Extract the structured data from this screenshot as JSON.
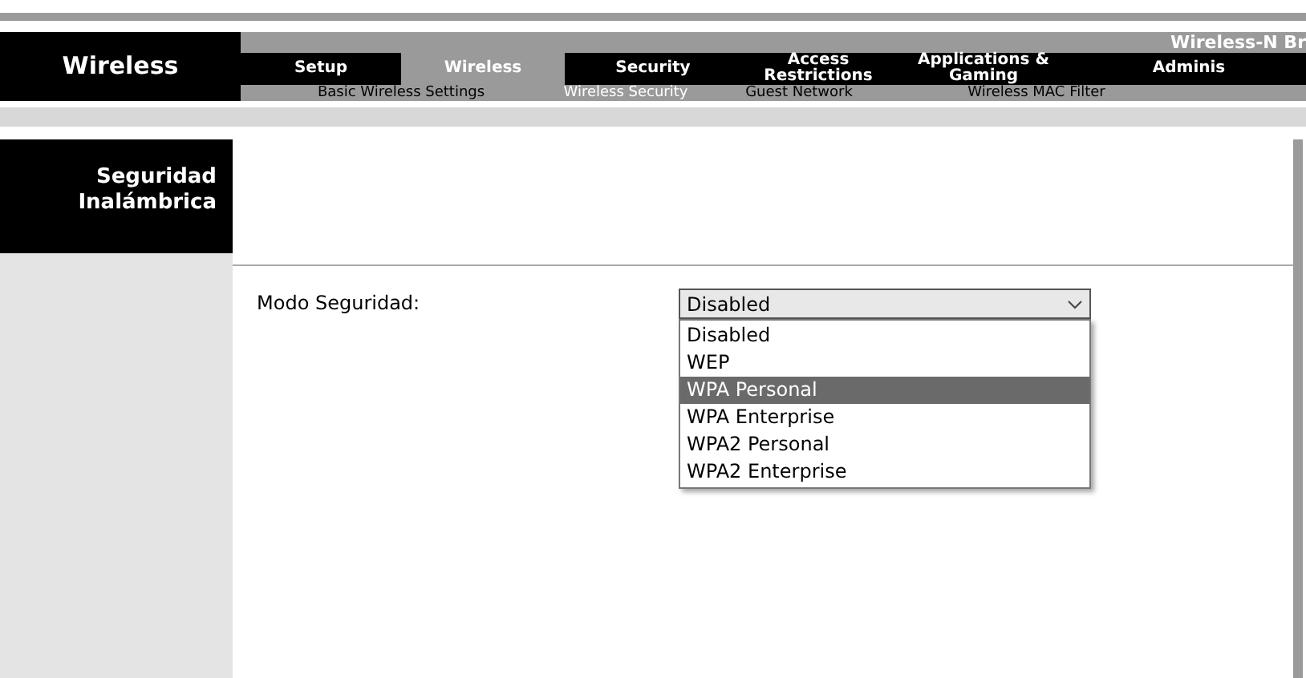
{
  "section_title": "Wireless",
  "product_name": "Wireless-N Br",
  "tabs": [
    {
      "label": "Setup",
      "selected": false
    },
    {
      "label": "Wireless",
      "selected": true
    },
    {
      "label": "Security",
      "selected": false
    },
    {
      "label": "Access Restrictions",
      "selected": false
    },
    {
      "label": "Applications & Gaming",
      "selected": false
    },
    {
      "label": "Adminis",
      "selected": false
    }
  ],
  "subtabs": [
    {
      "label": "Basic Wireless Settings",
      "selected": false
    },
    {
      "label": "Wireless Security",
      "selected": true
    },
    {
      "label": "Guest Network",
      "selected": false
    },
    {
      "label": "Wireless MAC Filter",
      "selected": false
    }
  ],
  "sidebar_heading": "Seguridad Inalámbrica",
  "form": {
    "label": "Modo Seguridad:",
    "value": "Disabled",
    "expanded": true,
    "options": [
      {
        "label": "Disabled",
        "highlighted": false
      },
      {
        "label": "WEP",
        "highlighted": false
      },
      {
        "label": "WPA Personal",
        "highlighted": true
      },
      {
        "label": "WPA Enterprise",
        "highlighted": false
      },
      {
        "label": "WPA2 Personal",
        "highlighted": false
      },
      {
        "label": "WPA2 Enterprise",
        "highlighted": false
      }
    ]
  }
}
